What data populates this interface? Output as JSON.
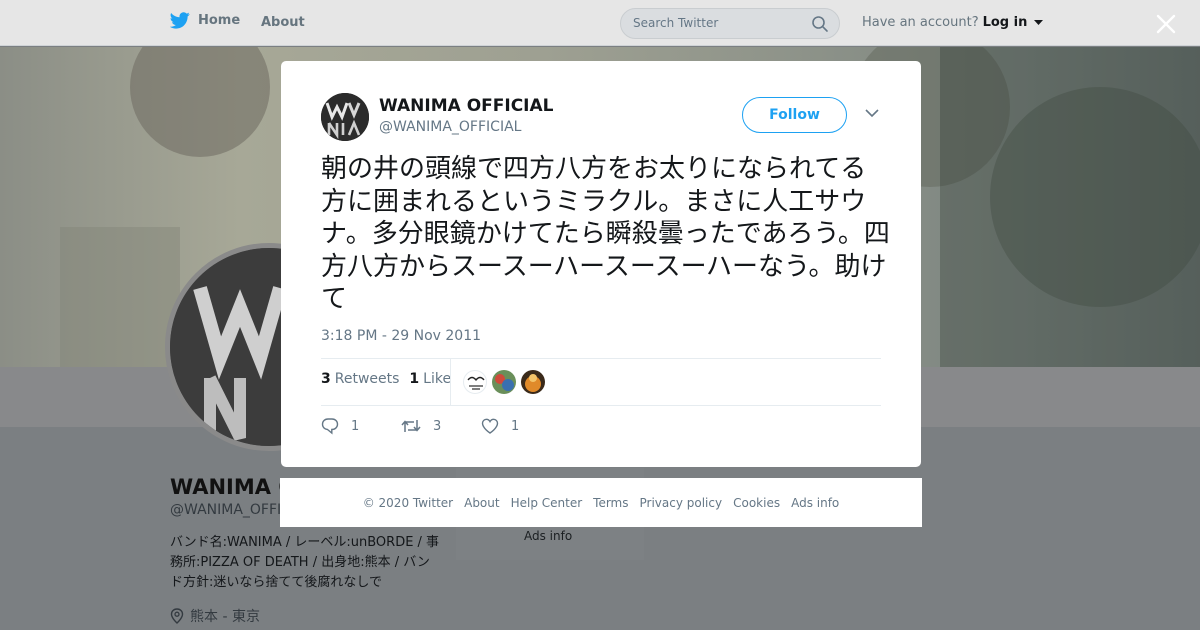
{
  "nav": {
    "home_label": "Home",
    "about_label": "About",
    "search_placeholder": "Search Twitter",
    "account_prompt": "Have an account?",
    "login_label": "Log in"
  },
  "background_profile": {
    "name": "WANIMA OF",
    "handle": "@WANIMA_OFFI",
    "bio": "バンド名:WANIMA / レーベル:unBORDE / 事務所:PIZZA OF DEATH / 出身地:熊本 / バンド方針:迷いなら捨てて後腐れなしで",
    "location": "熊本 - 東京",
    "side_ads_label": "Ads info"
  },
  "tweet": {
    "author_name": "WANIMA OFFICIAL",
    "author_handle": "@WANIMA_OFFICIAL",
    "follow_label": "Follow",
    "text": "朝の井の頭線で四方八方をお太りになられてる方に囲まれるというミラクル。まさに人工サウナ。多分眼鏡かけてたら瞬殺曇ったであろう。四方八方からスースーハースースーハーなう。助けて",
    "timestamp": "3:18 PM - 29 Nov 2011",
    "retweets_count": "3",
    "retweets_label": "Retweets",
    "likes_count": "1",
    "likes_label": "Like",
    "action_reply_count": "1",
    "action_retweet_count": "3",
    "action_like_count": "1"
  },
  "footer": {
    "links": [
      "© 2020 Twitter",
      "About",
      "Help Center",
      "Terms",
      "Privacy policy",
      "Cookies",
      "Ads info"
    ]
  },
  "colors": {
    "accent": "#1da1f2",
    "muted": "#657786",
    "overlay": "#7b7f82"
  }
}
